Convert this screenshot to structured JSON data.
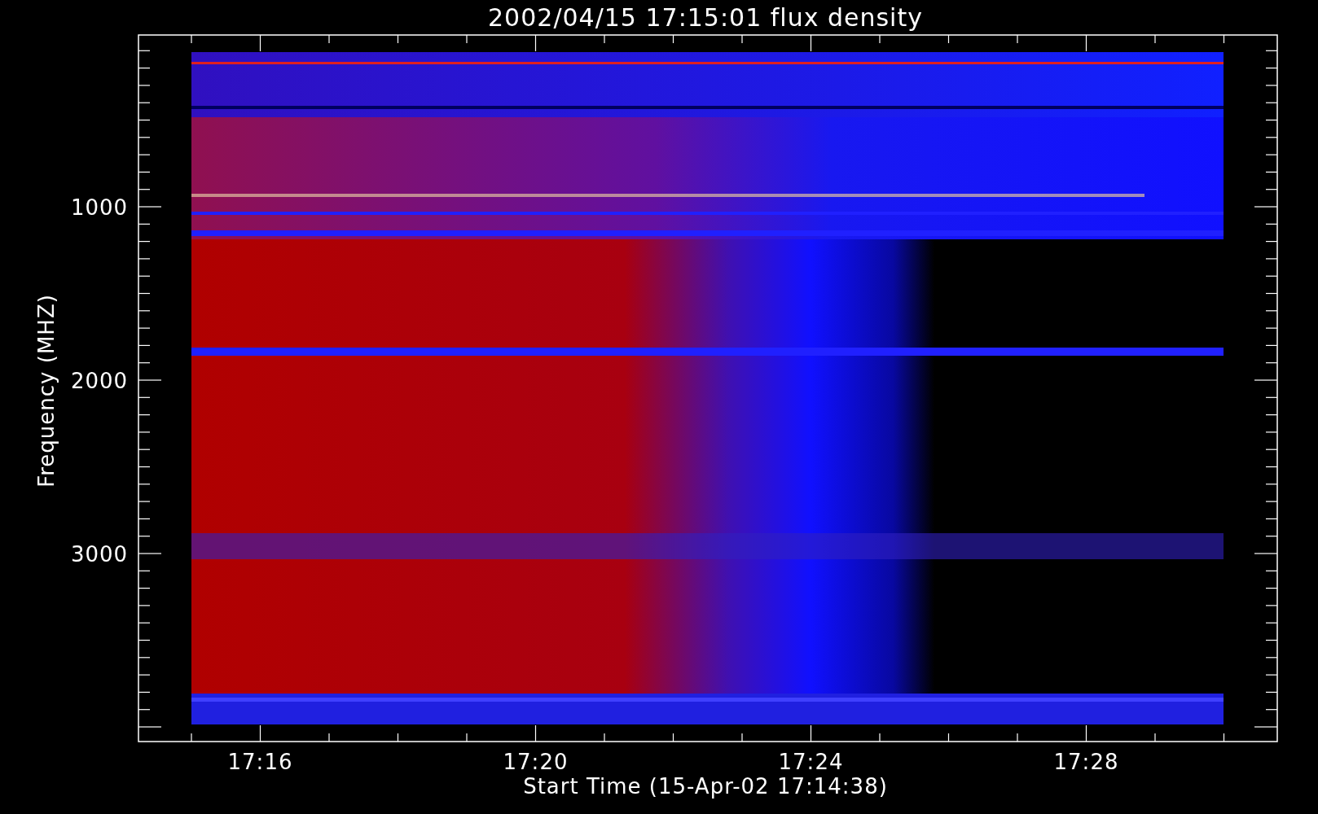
{
  "title": "2002/04/15 17:15:01 flux density",
  "x_axis": {
    "label": "Start Time (15-Apr-02 17:14:38)",
    "tick_labels": [
      "17:16",
      "17:20",
      "17:24",
      "17:28"
    ]
  },
  "y_axis": {
    "label": "Frequency (MHZ)",
    "tick_labels": [
      "1000",
      "2000",
      "3000"
    ]
  }
}
